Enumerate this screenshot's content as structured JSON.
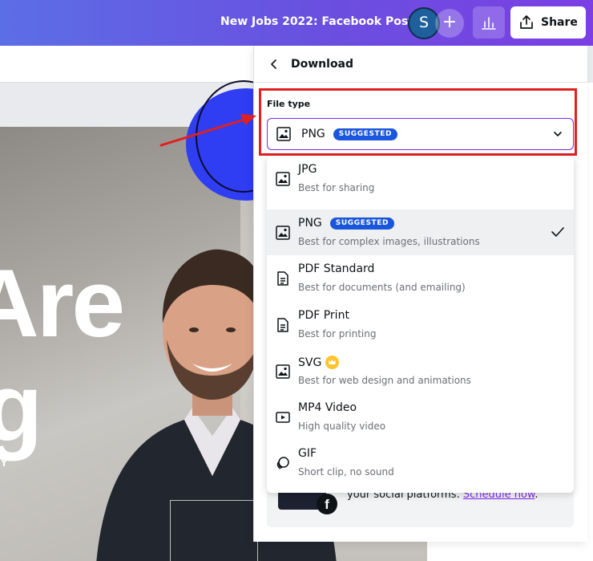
{
  "header": {
    "doc_title": "New Jobs 2022: Facebook Post",
    "avatar_initial": "S",
    "add_symbol": "+",
    "share_label": "Share"
  },
  "canvas": {
    "big_text_1": "Are",
    "big_text_2": "g",
    "small_text": "Y"
  },
  "panel": {
    "title": "Download",
    "file_type_label": "File type",
    "selected": {
      "name": "PNG",
      "badge": "SUGGESTED"
    },
    "options": [
      {
        "name": "JPG",
        "desc": "Best for sharing",
        "icon": "image-icon"
      },
      {
        "name": "PNG",
        "badge": "SUGGESTED",
        "desc": "Best for complex images, illustrations",
        "icon": "image-icon",
        "selected": true
      },
      {
        "name": "PDF Standard",
        "desc": "Best for documents (and emailing)",
        "icon": "document-icon"
      },
      {
        "name": "PDF Print",
        "desc": "Best for printing",
        "icon": "document-icon"
      },
      {
        "name": "SVG",
        "desc": "Best for web design and animations",
        "icon": "image-icon",
        "pro": true
      },
      {
        "name": "MP4 Video",
        "desc": "High quality video",
        "icon": "video-icon"
      },
      {
        "name": "GIF",
        "desc": "Short clip, no sound",
        "icon": "gif-icon"
      }
    ],
    "schedule": {
      "text": "your social platforms.",
      "link": "Schedule now",
      "end": "."
    }
  },
  "colors": {
    "accent_purple": "#7d2ae8",
    "badge_blue": "#1a56db",
    "highlight_red": "#e0201f",
    "pro_crown": "#ffc42e"
  }
}
